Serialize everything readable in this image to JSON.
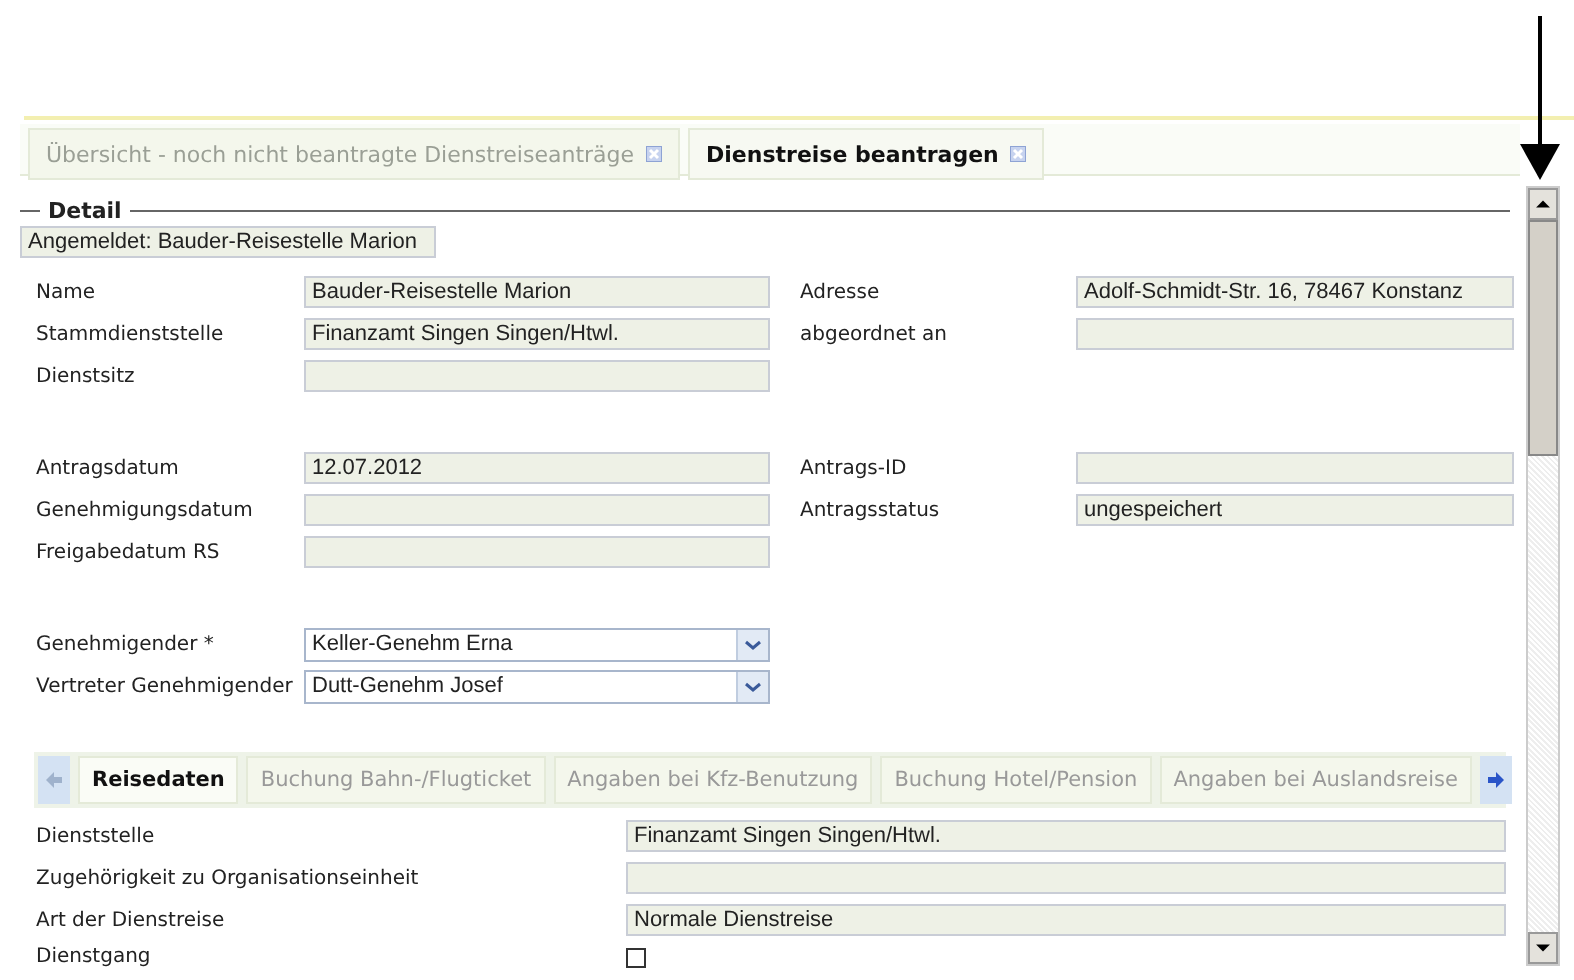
{
  "tabs": [
    {
      "label": "Übersicht - noch nicht beantragte Dienstreiseanträge",
      "selected": false
    },
    {
      "label": "Dienstreise beantragen",
      "selected": true
    }
  ],
  "detail": {
    "legend": "Detail",
    "logged_in": "Angemeldet: Bauder-Reisestelle Marion",
    "groups": [
      [
        {
          "label": "Name",
          "value": "Bauder-Reisestelle Marion"
        },
        {
          "label": "Adresse",
          "value": "Adolf-Schmidt-Str. 16, 78467 Konstanz"
        },
        {
          "label": "Stammdienststelle",
          "value": "Finanzamt Singen Singen/Htwl."
        },
        {
          "label": "abgeordnet an"
        },
        {
          "label": "Dienstsitz"
        }
      ],
      [
        {
          "label": "Antragsdatum",
          "value": "12.07.2012"
        },
        {
          "label": "Antrags-ID"
        },
        {
          "label": "Genehmigungsdatum"
        },
        {
          "label": "Antragsstatus",
          "value": "ungespeichert"
        },
        {
          "label": "Freigabedatum RS"
        }
      ]
    ],
    "selects": [
      {
        "label": "Genehmigender *",
        "value": "Keller-Genehm Erna"
      },
      {
        "label": "Vertreter Genehmigender",
        "value": "Dutt-Genehm Josef"
      }
    ]
  },
  "subtabs": [
    {
      "label": "Reisedaten",
      "selected": true
    },
    {
      "label": "Buchung Bahn-/Flugticket",
      "selected": false
    },
    {
      "label": "Angaben bei Kfz-Benutzung",
      "selected": false
    },
    {
      "label": "Buchung Hotel/Pension",
      "selected": false
    },
    {
      "label": "Angaben bei Auslandsreise",
      "selected": false
    }
  ],
  "travel_rows": [
    {
      "kind": "field",
      "label": "Dienststelle",
      "value": "Finanzamt Singen Singen/Htwl."
    },
    {
      "kind": "field",
      "label": "Zugehörigkeit zu Organisationseinheit"
    },
    {
      "kind": "field",
      "label": "Art der Dienstreise",
      "value": "Normale Dienstreise"
    },
    {
      "kind": "checkbox",
      "label": "Dienstgang",
      "checked": false
    }
  ]
}
